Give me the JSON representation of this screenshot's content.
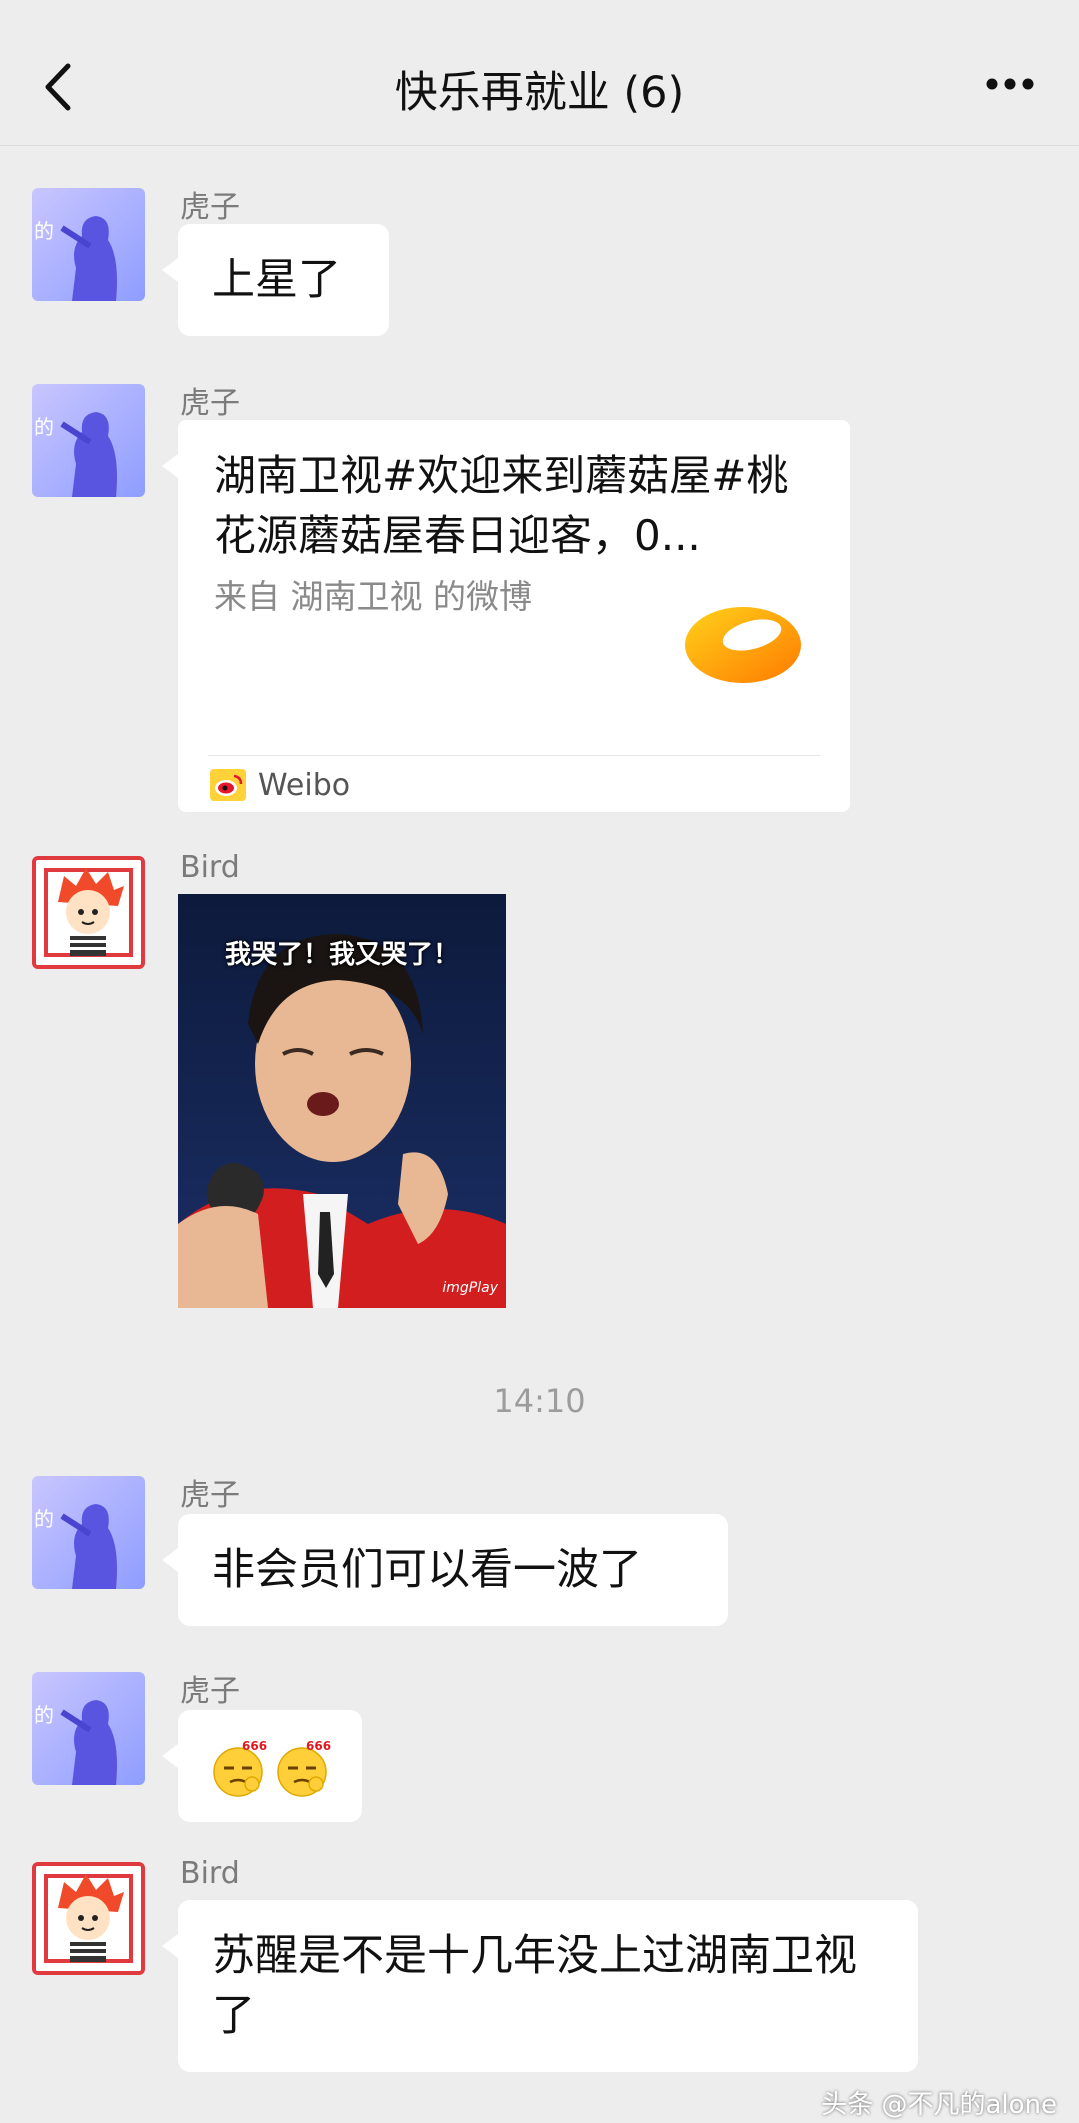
{
  "header": {
    "title": "快乐再就业 (6)"
  },
  "time_divider": "14:10",
  "messages": [
    {
      "sender": "虎子",
      "text": "上星了"
    },
    {
      "sender": "虎子",
      "card": {
        "title": "湖南卫视#欢迎来到蘑菇屋#桃花源蘑菇屋春日迎客，0...",
        "subtitle": "来自 湖南卫视 的微博",
        "source": "Weibo"
      }
    },
    {
      "sender": "Bird",
      "meme_caption": "我哭了！我又哭了！",
      "meme_watermark": "imgPlay"
    },
    {
      "sender": "虎子",
      "text": "非会员们可以看一波了"
    },
    {
      "sender": "虎子",
      "emoji_label": "666",
      "emoji_label_2": "666"
    },
    {
      "sender": "Bird",
      "text": "苏醒是不是十几年没上过湖南卫视了"
    }
  ],
  "watermark": "头条 @不凡的alone",
  "colors": {
    "background": "#ededed",
    "bubble": "#ffffff",
    "meta_text": "#7b7b7b"
  },
  "icons": [
    "back-arrow-icon",
    "more-dots-icon",
    "weibo-icon",
    "mango-tv-logo"
  ]
}
